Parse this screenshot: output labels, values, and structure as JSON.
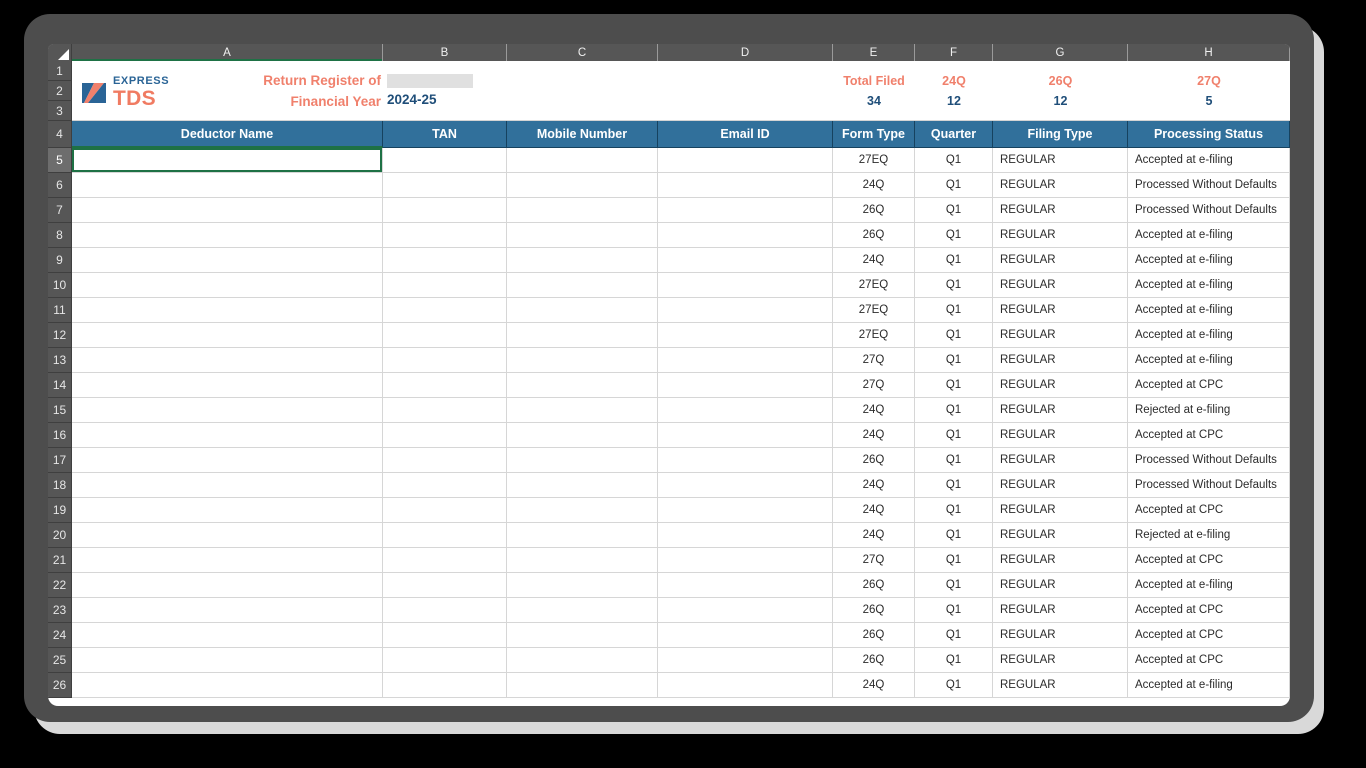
{
  "app": {
    "type": "spreadsheet",
    "colors": {
      "header_blue": "#31709b",
      "accent_salmon": "#f0806c",
      "value_blue": "#1f4e79",
      "selection_green": "#1e7145",
      "row_header_grey": "#565656",
      "frame_dark": "#4d4d4d"
    }
  },
  "grid": {
    "select_all_corner": "select-all-triangle",
    "column_letters": [
      "A",
      "B",
      "C",
      "D",
      "E",
      "F",
      "G",
      "H"
    ],
    "row_numbers": [
      "1",
      "2",
      "3",
      "4",
      "5",
      "6",
      "7",
      "8",
      "9",
      "10",
      "11",
      "12",
      "13",
      "14",
      "15",
      "16",
      "17",
      "18",
      "19",
      "20",
      "21",
      "22",
      "23",
      "24",
      "25",
      "26"
    ],
    "active_cell_row": "5",
    "active_cell_column": "A"
  },
  "logo": {
    "mark": "express-tds-logo-mark",
    "line1": "EXPRESS",
    "line2": "TDS"
  },
  "title": {
    "line1": "Return Register of",
    "line2": "Financial Year",
    "financial_year_value": "2024-25",
    "redacted_cell": true
  },
  "stats": [
    {
      "label": "Total Filed",
      "value": "34"
    },
    {
      "label": "24Q",
      "value": "12"
    },
    {
      "label": "26Q",
      "value": "12"
    },
    {
      "label": "27Q",
      "value": "5"
    }
  ],
  "table": {
    "columns": [
      "Deductor Name",
      "TAN",
      "Mobile Number",
      "Email ID",
      "Form Type",
      "Quarter",
      "Filing Type",
      "Processing Status"
    ],
    "rows": [
      {
        "row": "5",
        "deductor_name": "",
        "tan": "",
        "mobile": "",
        "email": "",
        "form_type": "27EQ",
        "quarter": "Q1",
        "filing_type": "REGULAR",
        "processing_status": "Accepted at e-filing"
      },
      {
        "row": "6",
        "deductor_name": "",
        "tan": "",
        "mobile": "",
        "email": "",
        "form_type": "24Q",
        "quarter": "Q1",
        "filing_type": "REGULAR",
        "processing_status": "Processed Without Defaults"
      },
      {
        "row": "7",
        "deductor_name": "",
        "tan": "",
        "mobile": "",
        "email": "",
        "form_type": "26Q",
        "quarter": "Q1",
        "filing_type": "REGULAR",
        "processing_status": "Processed Without Defaults"
      },
      {
        "row": "8",
        "deductor_name": "",
        "tan": "",
        "mobile": "",
        "email": "",
        "form_type": "26Q",
        "quarter": "Q1",
        "filing_type": "REGULAR",
        "processing_status": "Accepted at e-filing"
      },
      {
        "row": "9",
        "deductor_name": "",
        "tan": "",
        "mobile": "",
        "email": "",
        "form_type": "24Q",
        "quarter": "Q1",
        "filing_type": "REGULAR",
        "processing_status": "Accepted at e-filing"
      },
      {
        "row": "10",
        "deductor_name": "",
        "tan": "",
        "mobile": "",
        "email": "",
        "form_type": "27EQ",
        "quarter": "Q1",
        "filing_type": "REGULAR",
        "processing_status": "Accepted at e-filing"
      },
      {
        "row": "11",
        "deductor_name": "",
        "tan": "",
        "mobile": "",
        "email": "",
        "form_type": "27EQ",
        "quarter": "Q1",
        "filing_type": "REGULAR",
        "processing_status": "Accepted at e-filing"
      },
      {
        "row": "12",
        "deductor_name": "",
        "tan": "",
        "mobile": "",
        "email": "",
        "form_type": "27EQ",
        "quarter": "Q1",
        "filing_type": "REGULAR",
        "processing_status": "Accepted at e-filing"
      },
      {
        "row": "13",
        "deductor_name": "",
        "tan": "",
        "mobile": "",
        "email": "",
        "form_type": "27Q",
        "quarter": "Q1",
        "filing_type": "REGULAR",
        "processing_status": "Accepted at e-filing"
      },
      {
        "row": "14",
        "deductor_name": "",
        "tan": "",
        "mobile": "",
        "email": "",
        "form_type": "27Q",
        "quarter": "Q1",
        "filing_type": "REGULAR",
        "processing_status": "Accepted at CPC"
      },
      {
        "row": "15",
        "deductor_name": "",
        "tan": "",
        "mobile": "",
        "email": "",
        "form_type": "24Q",
        "quarter": "Q1",
        "filing_type": "REGULAR",
        "processing_status": "Rejected at e-filing"
      },
      {
        "row": "16",
        "deductor_name": "",
        "tan": "",
        "mobile": "",
        "email": "",
        "form_type": "24Q",
        "quarter": "Q1",
        "filing_type": "REGULAR",
        "processing_status": "Accepted at CPC"
      },
      {
        "row": "17",
        "deductor_name": "",
        "tan": "",
        "mobile": "",
        "email": "",
        "form_type": "26Q",
        "quarter": "Q1",
        "filing_type": "REGULAR",
        "processing_status": "Processed Without Defaults"
      },
      {
        "row": "18",
        "deductor_name": "",
        "tan": "",
        "mobile": "",
        "email": "",
        "form_type": "24Q",
        "quarter": "Q1",
        "filing_type": "REGULAR",
        "processing_status": "Processed Without Defaults"
      },
      {
        "row": "19",
        "deductor_name": "",
        "tan": "",
        "mobile": "",
        "email": "",
        "form_type": "24Q",
        "quarter": "Q1",
        "filing_type": "REGULAR",
        "processing_status": "Accepted at CPC"
      },
      {
        "row": "20",
        "deductor_name": "",
        "tan": "",
        "mobile": "",
        "email": "",
        "form_type": "24Q",
        "quarter": "Q1",
        "filing_type": "REGULAR",
        "processing_status": "Rejected at e-filing"
      },
      {
        "row": "21",
        "deductor_name": "",
        "tan": "",
        "mobile": "",
        "email": "",
        "form_type": "27Q",
        "quarter": "Q1",
        "filing_type": "REGULAR",
        "processing_status": "Accepted at CPC"
      },
      {
        "row": "22",
        "deductor_name": "",
        "tan": "",
        "mobile": "",
        "email": "",
        "form_type": "26Q",
        "quarter": "Q1",
        "filing_type": "REGULAR",
        "processing_status": "Accepted at e-filing"
      },
      {
        "row": "23",
        "deductor_name": "",
        "tan": "",
        "mobile": "",
        "email": "",
        "form_type": "26Q",
        "quarter": "Q1",
        "filing_type": "REGULAR",
        "processing_status": "Accepted at CPC"
      },
      {
        "row": "24",
        "deductor_name": "",
        "tan": "",
        "mobile": "",
        "email": "",
        "form_type": "26Q",
        "quarter": "Q1",
        "filing_type": "REGULAR",
        "processing_status": "Accepted at CPC"
      },
      {
        "row": "25",
        "deductor_name": "",
        "tan": "",
        "mobile": "",
        "email": "",
        "form_type": "26Q",
        "quarter": "Q1",
        "filing_type": "REGULAR",
        "processing_status": "Accepted at CPC"
      },
      {
        "row": "26",
        "deductor_name": "",
        "tan": "",
        "mobile": "",
        "email": "",
        "form_type": "24Q",
        "quarter": "Q1",
        "filing_type": "REGULAR",
        "processing_status": "Accepted at e-filing"
      }
    ]
  }
}
